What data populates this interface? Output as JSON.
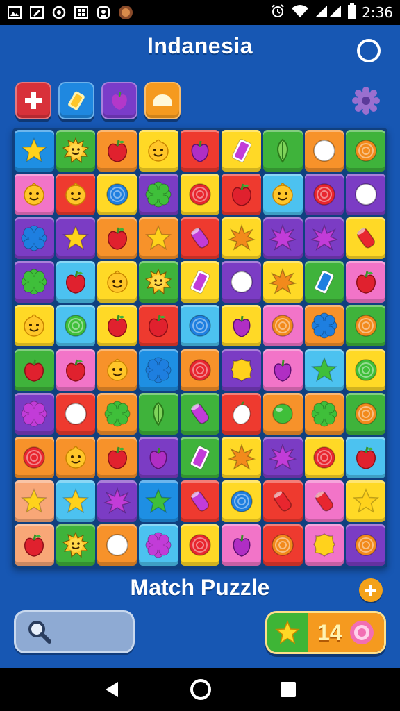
{
  "status_bar": {
    "time": "2:36",
    "left_icons": [
      "gallery-icon",
      "edit-icon",
      "chrome-icon",
      "grid-icon",
      "photo-icon",
      "avatar-icon"
    ],
    "right_icons": [
      "alarm-icon",
      "wifi-icon",
      "signal-icon",
      "battery-icon"
    ]
  },
  "header": {
    "title": "Indanesia"
  },
  "powerups": [
    {
      "name": "plus-powerup",
      "color": "#d8313a"
    },
    {
      "name": "card-powerup",
      "color": "#1f88e0"
    },
    {
      "name": "plum-powerup",
      "color": "#7a3cc9"
    },
    {
      "name": "dome-powerup",
      "color": "#f59a1f"
    }
  ],
  "board": {
    "columns": 9,
    "rows": 10,
    "tiles": [
      [
        "blue:star-y",
        "green:sun",
        "orange:apple",
        "yellow:face",
        "red:plum",
        "yellow:card-p",
        "green:leaf",
        "orange:coin",
        "green:swirl-o"
      ],
      [
        "pink:face",
        "red:face",
        "yellow:swirl-b",
        "purple:flower-g",
        "yellow:swirl-r",
        "red:apple",
        "sky:face",
        "purple:swirl-r",
        "purple:coin"
      ],
      [
        "purple:flower-b",
        "purple:star-y",
        "orange:apple",
        "orange:star-y",
        "red:candy-p",
        "yellow:starburst-o",
        "purple:starburst-p",
        "purple:starburst-p",
        "yellow:candy-r"
      ],
      [
        "purple:flower-g",
        "sky:apple",
        "yellow:face",
        "green:sun",
        "yellow:card-p",
        "purple:coin",
        "yellow:starburst-o",
        "green:card-b",
        "pink:apple"
      ],
      [
        "yellow:face",
        "sky:swirl-g",
        "yellow:apple",
        "red:apple",
        "sky:swirl-b",
        "yellow:plum",
        "pink:swirl-o",
        "orange:flower-b",
        "green:swirl-o"
      ],
      [
        "green:apple",
        "pink:apple",
        "orange:face",
        "blue:flower-b",
        "orange:swirl-r",
        "purple:blob-y",
        "pink:plum",
        "sky:star-g",
        "yellow:swirl-g"
      ],
      [
        "purple:flower-p",
        "red:coin",
        "orange:flower-g",
        "green:leaf",
        "green:candy-p",
        "red:lemon",
        "orange:ball-g",
        "orange:flower-g",
        "green:swirl-o"
      ],
      [
        "orange:swirl-r",
        "orange:face",
        "orange:apple",
        "purple:plum",
        "green:card-p",
        "yellow:starburst-o",
        "purple:starburst-p",
        "yellow:swirl-r",
        "sky:apple"
      ],
      [
        "peach:star-y",
        "sky:star-y",
        "purple:starburst-p",
        "blue:star-g",
        "red:candy-p",
        "yellow:swirl-b",
        "red:candy-r",
        "pink:candy-r",
        "yellow:star-y"
      ],
      [
        "peach:apple",
        "green:sun",
        "orange:coin",
        "sky:flower-p",
        "yellow:swirl-r",
        "pink:plum",
        "red:swirl-o",
        "pink:blob-y",
        "purple:swirl-o"
      ]
    ]
  },
  "footer": {
    "subtitle": "Match Puzzle",
    "score": "14"
  },
  "colors": {
    "background": "#1757b3",
    "tile_red": "#ee3a2f",
    "tile_orange": "#f7922a",
    "tile_yellow": "#ffd926",
    "tile_green": "#3fb33b",
    "tile_blue": "#1e8fe3",
    "tile_sky": "#4cc2f0",
    "tile_purple": "#7b3cc4",
    "tile_pink": "#f274c8",
    "tile_peach": "#f8a777"
  }
}
